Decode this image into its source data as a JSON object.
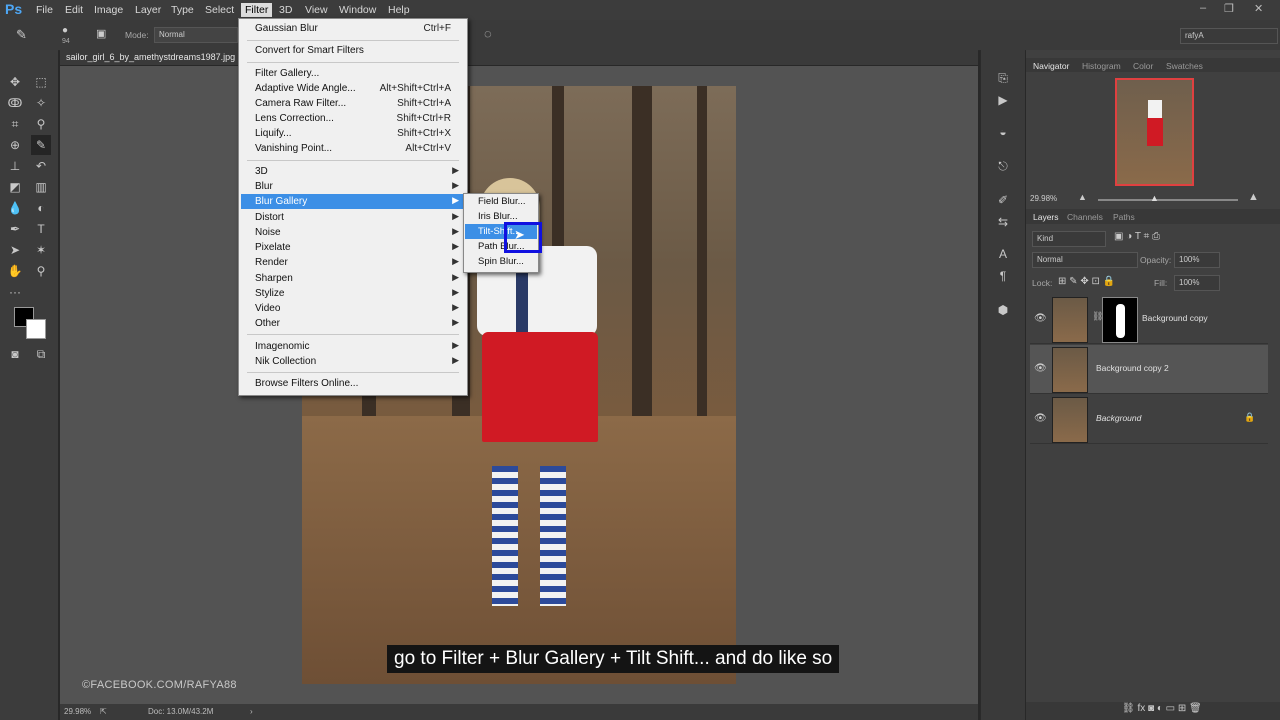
{
  "app": {
    "logo": "Ps"
  },
  "menubar": {
    "items": [
      "File",
      "Edit",
      "Image",
      "Layer",
      "Type",
      "Select",
      "Filter",
      "3D",
      "View",
      "Window",
      "Help"
    ],
    "active": "Filter"
  },
  "options": {
    "brush_size": "94",
    "mode_label": "Mode:",
    "mode_value": "Normal",
    "workspace": "rafyA"
  },
  "document": {
    "tab_title": "sailor_girl_6_by_amethystdreams1987.jpg",
    "zoom": "29.98%",
    "doc_size": "Doc: 13.0M/43.2M"
  },
  "filter_menu": {
    "items": [
      {
        "label": "Gaussian Blur",
        "shortcut": "Ctrl+F"
      },
      {
        "label": "Convert for Smart Filters",
        "shortcut": ""
      },
      {
        "label": "Filter Gallery...",
        "shortcut": ""
      },
      {
        "label": "Adaptive Wide Angle...",
        "shortcut": "Alt+Shift+Ctrl+A"
      },
      {
        "label": "Camera Raw Filter...",
        "shortcut": "Shift+Ctrl+A"
      },
      {
        "label": "Lens Correction...",
        "shortcut": "Shift+Ctrl+R"
      },
      {
        "label": "Liquify...",
        "shortcut": "Shift+Ctrl+X"
      },
      {
        "label": "Vanishing Point...",
        "shortcut": "Alt+Ctrl+V"
      },
      {
        "label": "3D",
        "shortcut": ""
      },
      {
        "label": "Blur",
        "shortcut": ""
      },
      {
        "label": "Blur Gallery",
        "shortcut": ""
      },
      {
        "label": "Distort",
        "shortcut": ""
      },
      {
        "label": "Noise",
        "shortcut": ""
      },
      {
        "label": "Pixelate",
        "shortcut": ""
      },
      {
        "label": "Render",
        "shortcut": ""
      },
      {
        "label": "Sharpen",
        "shortcut": ""
      },
      {
        "label": "Stylize",
        "shortcut": ""
      },
      {
        "label": "Video",
        "shortcut": ""
      },
      {
        "label": "Other",
        "shortcut": ""
      },
      {
        "label": "Imagenomic",
        "shortcut": ""
      },
      {
        "label": "Nik Collection",
        "shortcut": ""
      },
      {
        "label": "Browse Filters Online...",
        "shortcut": ""
      }
    ]
  },
  "blur_gallery_submenu": {
    "items": [
      "Field Blur...",
      "Iris Blur...",
      "Tilt-Shift...",
      "Path Blur...",
      "Spin Blur..."
    ],
    "highlighted": "Tilt-Shift..."
  },
  "navigator": {
    "tabs": [
      "Navigator",
      "Histogram",
      "Color",
      "Swatches"
    ],
    "zoom": "29.98%"
  },
  "layers_panel": {
    "tabs": [
      "Layers",
      "Channels",
      "Paths"
    ],
    "filter_kind": "Kind",
    "blend_mode": "Normal",
    "opacity_label": "Opacity:",
    "opacity_value": "100%",
    "lock_label": "Lock:",
    "fill_label": "Fill:",
    "fill_value": "100%",
    "layers": [
      {
        "name": "Background copy"
      },
      {
        "name": "Background copy 2"
      },
      {
        "name": "Background"
      }
    ]
  },
  "overlay": {
    "watermark": "©FACEBOOK.COM/RAFYA88",
    "caption": "go to Filter + Blur Gallery + Tilt Shift... and do like so"
  },
  "colors": {
    "menu_highlight": "#3c8fe6",
    "focus_box": "#1010e0",
    "nav_frame": "#e04040"
  }
}
